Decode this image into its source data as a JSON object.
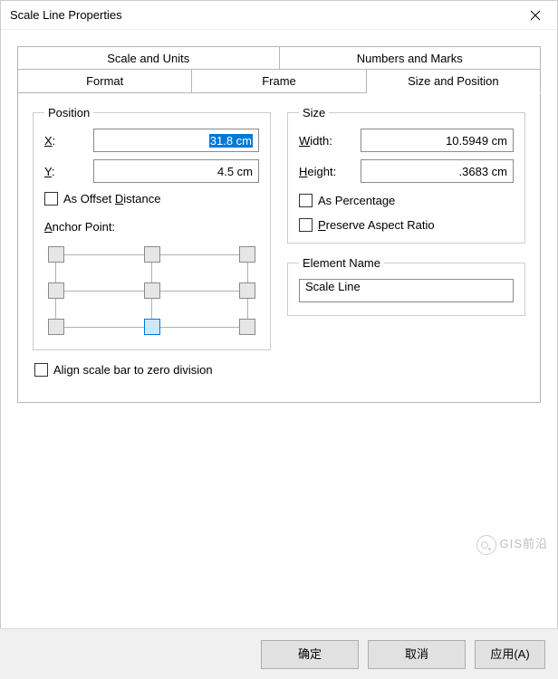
{
  "window": {
    "title": "Scale Line Properties"
  },
  "tabs": {
    "scale_units": "Scale and Units",
    "numbers_marks": "Numbers and Marks",
    "format": "Format",
    "frame": "Frame",
    "size_position": "Size and Position"
  },
  "position": {
    "legend": "Position",
    "x_label": "X:",
    "x_value": "31.8 cm",
    "y_label": "Y:",
    "y_value": "4.5 cm",
    "offset_label": "As Offset Distance",
    "anchor_label": "Anchor Point:"
  },
  "size": {
    "legend": "Size",
    "width_label": "Width:",
    "width_value": "10.5949 cm",
    "height_label": "Height:",
    "height_value": ".3683 cm",
    "percentage_label": "As Percentage",
    "preserve_label": "Preserve Aspect Ratio"
  },
  "element_name": {
    "legend": "Element Name",
    "value": "Scale Line"
  },
  "align_label": "Align scale bar to zero division",
  "buttons": {
    "ok": "确定",
    "cancel": "取消",
    "apply": "应用(A)"
  },
  "watermark": "GIS前沿"
}
